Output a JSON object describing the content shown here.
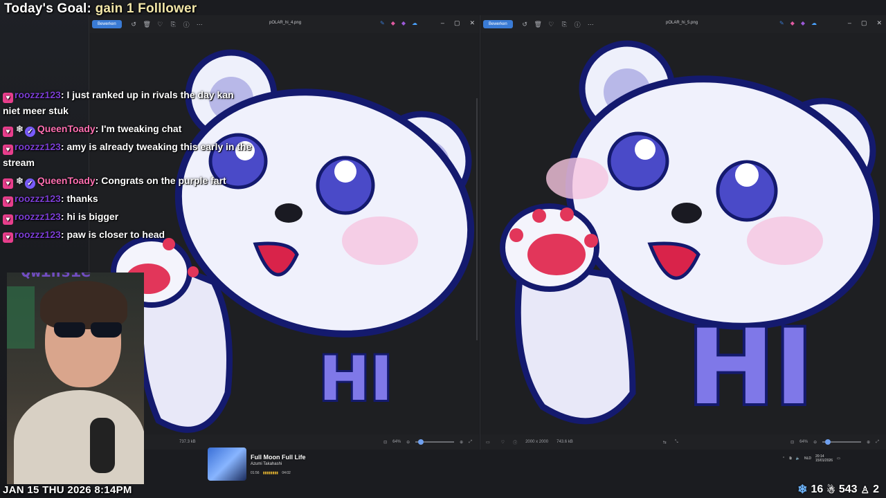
{
  "overlay": {
    "goal_prefix": "Today's Goal:",
    "goal_text": "gain 1 Folllower",
    "datetime": "JAN 15 THU 2026 8:14PM",
    "followers": "16",
    "subs": "543",
    "viewers": "2"
  },
  "viewer_left": {
    "edit_label": "Bewerken",
    "filename": "pOLAR_hi_4.png",
    "file_size": "737.3 kB",
    "zoom": "64%",
    "image_text": "HI"
  },
  "viewer_right": {
    "edit_label": "Bewerken",
    "filename": "pOLAR_hi_5.png",
    "dimensions": "2000 x 2000",
    "file_size": "743.6 kB",
    "zoom": "64%",
    "image_text": "HI"
  },
  "chat": [
    {
      "user": "roozzz123",
      "text": "I just ranked up in rivals the day kan niet meer stuk"
    },
    {
      "user": "QueenToady",
      "text": "I'm tweaking chat"
    },
    {
      "user": "roozzz123",
      "text": "amy is already tweaking this early in the stream"
    },
    {
      "user": "QueenToady",
      "text": "Congrats on the purple fart"
    },
    {
      "user": "roozzz123",
      "text": "thanks"
    },
    {
      "user": "roozzz123",
      "text": "hi is bigger"
    },
    {
      "user": "roozzz123",
      "text": "paw is closer to head"
    }
  ],
  "webcam": {
    "neon_sign": "Qwinsie"
  },
  "media": {
    "song_title": "Full Moon Full Life",
    "artist": "Azumi Takahashi",
    "elapsed": "01:56",
    "total": "04:02"
  },
  "taskbar": {
    "lang": "NLD",
    "time": "20:14",
    "date": "15/01/2026"
  },
  "colors": {
    "accent_blue": "#3a7bd5",
    "badge_pink": "#e83e8c",
    "username_pink": "#ff6fb1",
    "username_purple": "#7b3dd4"
  }
}
